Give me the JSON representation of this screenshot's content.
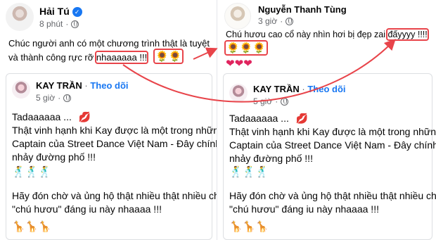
{
  "left": {
    "author": "Hải Tú",
    "time": "8 phút",
    "text_line1": "Chúc người anh có một chương trình thật là tuyệt",
    "text_line2_prefix": "và thành công rực rỡ ",
    "text_line2_highlight": "nhaaaaaa !!!",
    "emojis": "🌻🌻",
    "shared": {
      "author": "KAY TRẦN",
      "follow": "Theo dõi",
      "time": "5 giờ",
      "lines": [
        "Tadaaaaaa ...",
        "Thật vinh hạnh khi Kay được là một trong những",
        "Captain của Street Dance Việt Nam - Đây chính là",
        "nhảy đường phố !!!"
      ],
      "kiss_emoji": "💋",
      "dancers": "🕺🕺🕺",
      "lines2": [
        "Hãy đón chờ và ủng hộ thật nhiều thật nhiều cho",
        "\"chú hươu\" đáng iu này nhaaaa !!!"
      ],
      "giraffes": "🦒🦒🦒"
    }
  },
  "right": {
    "author": "Nguyễn Thanh Tùng",
    "time": "3 giờ",
    "text_prefix": "Chú hươu cao cổ này nhìn hơi bị đẹp zai ",
    "text_highlight": "đấyyyy !!!!",
    "emojis": "🌻🌻🌻",
    "hearts": "❤❤❤",
    "shared": {
      "author": "KAY TRẦN",
      "follow": "Theo dõi",
      "time": "5 giờ",
      "lines": [
        "Tadaaaaaa ...",
        "Thật vinh hạnh khi Kay được là một trong những",
        "Captain của Street Dance Việt Nam - Đây chính là",
        "nhảy đường phố !!!"
      ],
      "kiss_emoji": "💋",
      "dancers": "🕺🕺🕺",
      "lines2": [
        "Hãy đón chờ và ủng hộ thật nhiều thật nhiều cho",
        "\"chú hươu\" đáng iu này nhaaaa !!!"
      ],
      "giraffes": "🦒🦒🦒"
    }
  },
  "colors": {
    "highlight": "#e8444a",
    "link": "#1877f2",
    "meta": "#65676b"
  }
}
